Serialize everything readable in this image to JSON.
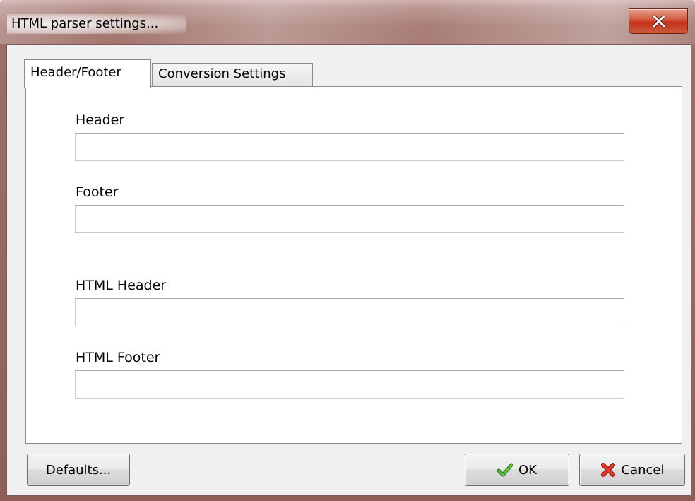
{
  "window": {
    "title": "HTML parser settings..."
  },
  "titlebar": {
    "close_icon": "close-icon",
    "close_color": "#c4321a"
  },
  "tabs": [
    {
      "label": "Header/Footer",
      "active": true
    },
    {
      "label": "Conversion Settings",
      "active": false
    }
  ],
  "fields": {
    "header": {
      "label": "Header",
      "value": ""
    },
    "footer": {
      "label": "Footer",
      "value": ""
    },
    "html_header": {
      "label": "HTML Header",
      "value": ""
    },
    "html_footer": {
      "label": "HTML Footer",
      "value": ""
    }
  },
  "buttons": {
    "defaults": {
      "label": "Defaults..."
    },
    "ok": {
      "label": "OK",
      "icon": "checkmark-icon",
      "icon_color": "#3a9a1e"
    },
    "cancel": {
      "label": "Cancel",
      "icon": "red-x-icon",
      "icon_color": "#d8201a"
    }
  }
}
